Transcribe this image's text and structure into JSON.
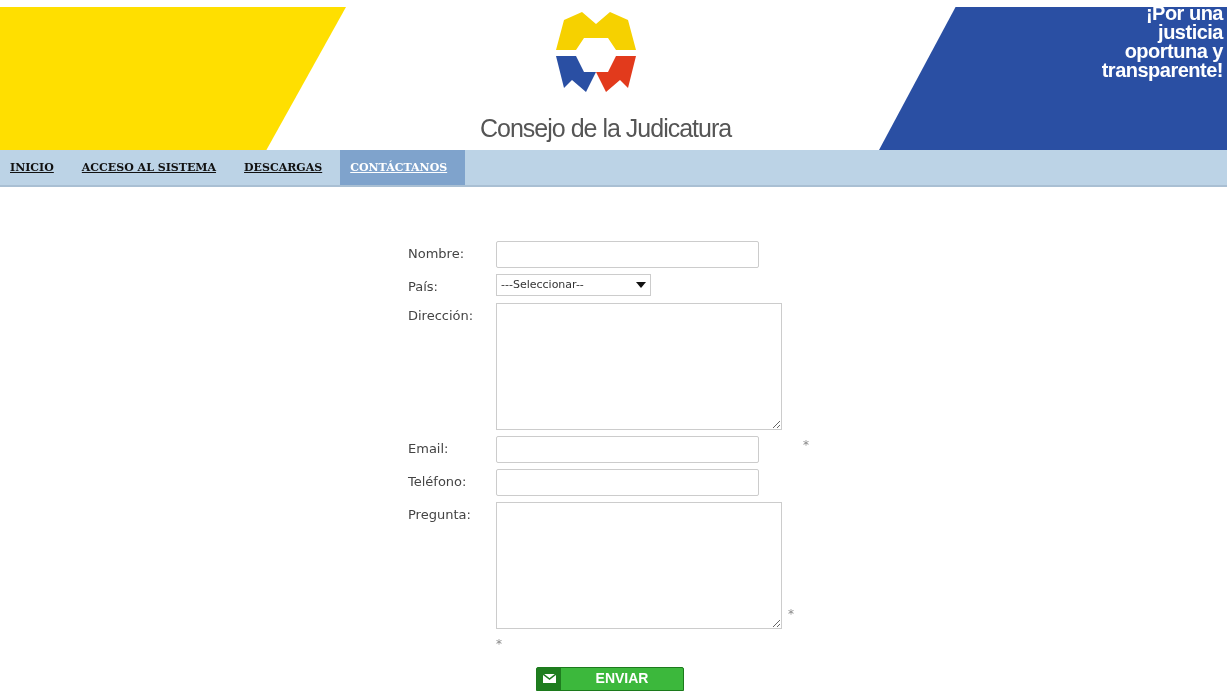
{
  "header": {
    "brand": "Consejo de la Judicatura",
    "slogan": [
      "¡Por una",
      "justicia",
      "oportuna y",
      "transparente!"
    ]
  },
  "nav": [
    {
      "label": "INICIO",
      "selected": false
    },
    {
      "label": "ACCESO AL SISTEMA",
      "selected": false
    },
    {
      "label": "DESCARGAS",
      "selected": false
    },
    {
      "label": "CONTÁCTANOS",
      "selected": true
    }
  ],
  "form": {
    "fields": [
      {
        "kind": "text",
        "label": "Nombre:"
      },
      {
        "kind": "select",
        "label": "País:",
        "value": "---Seleccionar--"
      },
      {
        "kind": "textarea",
        "label": "Dirección:"
      },
      {
        "kind": "text",
        "label": "Email:",
        "required_mark": "*"
      },
      {
        "kind": "text",
        "label": "Teléfono:"
      },
      {
        "kind": "textarea",
        "label": "Pregunta:",
        "required_mark": "*"
      }
    ],
    "footnote": "*",
    "submit": "ENVIAR"
  }
}
